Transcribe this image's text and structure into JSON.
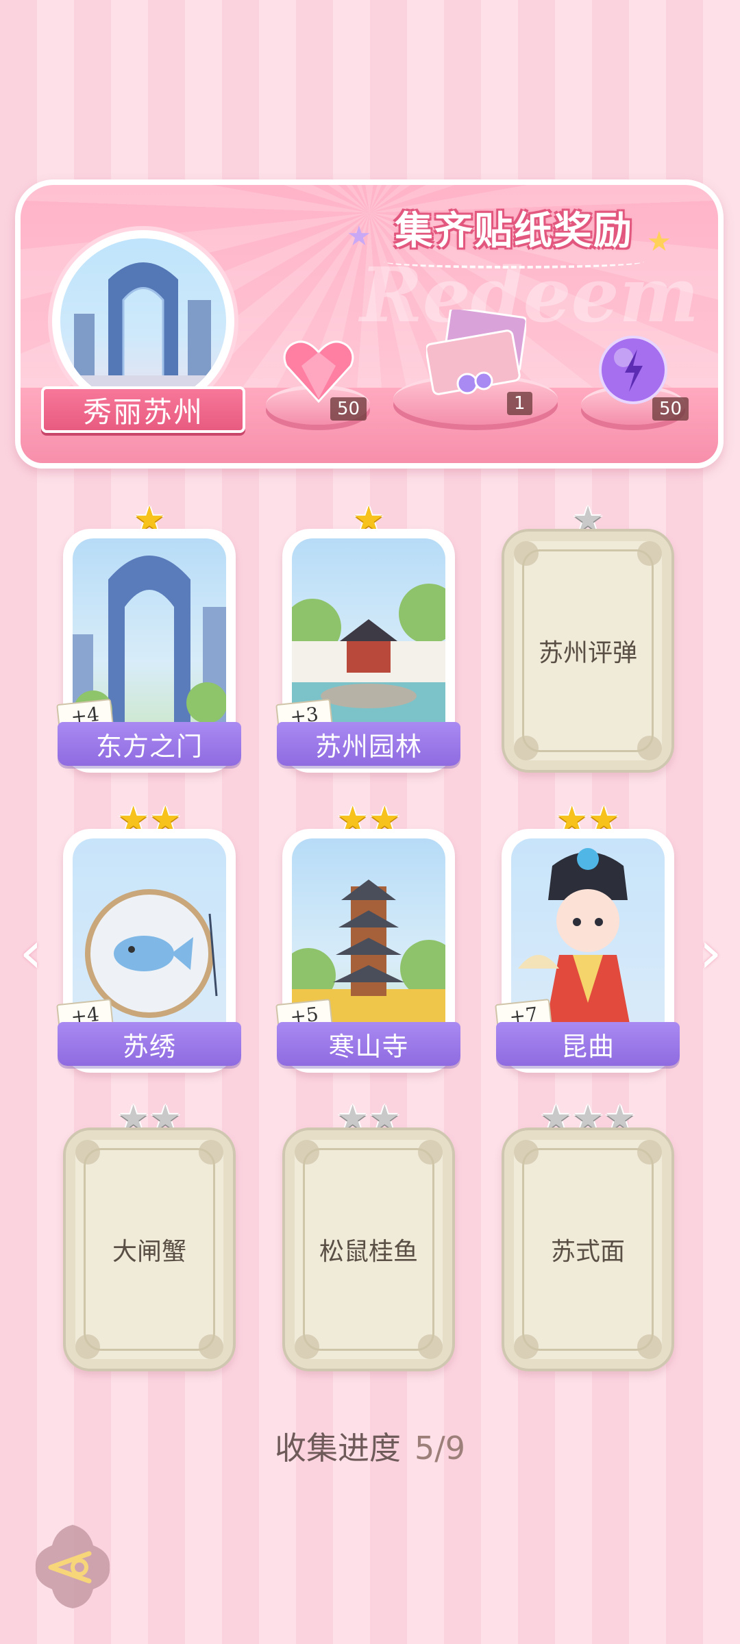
{
  "banner": {
    "title": "集齐贴纸奖励",
    "watermark": "Redeem",
    "city_name": "秀丽苏州",
    "rewards": [
      {
        "name": "heart-gem",
        "count": "50"
      },
      {
        "name": "gift-box",
        "count": "1"
      },
      {
        "name": "energy-orb",
        "count": "50"
      }
    ]
  },
  "cards": [
    {
      "name": "东方之门",
      "stars": 1,
      "collected": true,
      "bonus": "+4"
    },
    {
      "name": "苏州园林",
      "stars": 1,
      "collected": true,
      "bonus": "+3"
    },
    {
      "name": "苏州评弹",
      "stars": 1,
      "collected": false,
      "bonus": ""
    },
    {
      "name": "苏绣",
      "stars": 2,
      "collected": true,
      "bonus": "+4"
    },
    {
      "name": "寒山寺",
      "stars": 2,
      "collected": true,
      "bonus": "+5"
    },
    {
      "name": "昆曲",
      "stars": 2,
      "collected": true,
      "bonus": "+7"
    },
    {
      "name": "大闸蟹",
      "stars": 2,
      "collected": false,
      "bonus": ""
    },
    {
      "name": "松鼠桂鱼",
      "stars": 2,
      "collected": false,
      "bonus": ""
    },
    {
      "name": "苏式面",
      "stars": 3,
      "collected": false,
      "bonus": ""
    }
  ],
  "progress": {
    "label": "收集进度",
    "value": "5/9"
  },
  "nav": {
    "prev_glyph": "‹",
    "next_glyph": "›"
  },
  "colors": {
    "accent_pink": "#e85b80",
    "label_purple": "#8f6be0",
    "star_gold": "#f7c21b",
    "star_gray": "#c9c9c9"
  }
}
